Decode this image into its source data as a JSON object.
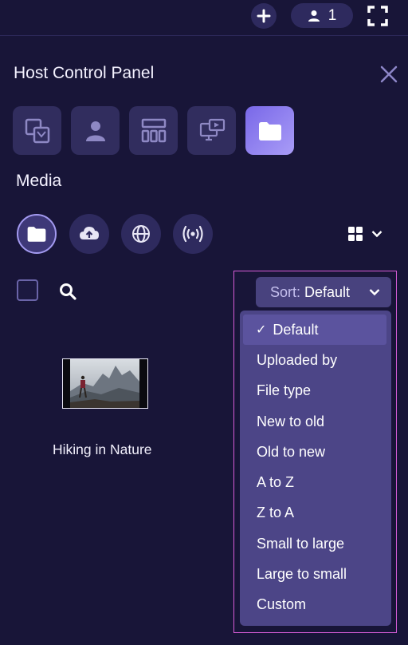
{
  "topbar": {
    "participant_count": "1",
    "icons": {
      "add": "plus-icon",
      "participants": "person-icon",
      "fullscreen": "fullscreen-icon"
    }
  },
  "panel": {
    "title": "Host Control Panel",
    "close_icon": "close-icon",
    "tools": [
      "layout-icon",
      "person-icon",
      "grid-icon",
      "screen-share-icon",
      "folder-icon"
    ],
    "active_tool": "folder-icon"
  },
  "media": {
    "section_label": "Media",
    "sources": [
      "folder-icon",
      "cloud-upload-icon",
      "globe-icon",
      "broadcast-icon"
    ],
    "active_source": "folder-icon",
    "view_icon": "grid-view-icon"
  },
  "sort": {
    "prefix": "Sort:",
    "value": "Default",
    "options": [
      {
        "label": "Default",
        "selected": true
      },
      {
        "label": "Uploaded by"
      },
      {
        "label": "File type"
      },
      {
        "label": "New to old"
      },
      {
        "label": "Old to new"
      },
      {
        "label": "A to Z"
      },
      {
        "label": "Z to A"
      },
      {
        "label": "Small to large"
      },
      {
        "label": "Large to small"
      },
      {
        "label": "Custom"
      }
    ]
  },
  "files": [
    {
      "name": "Hiking in Nature"
    }
  ],
  "colors": {
    "background": "#181538",
    "accent": "#8b7cf0",
    "dropdown": "#4c4587",
    "highlight": "#d65cd6"
  }
}
